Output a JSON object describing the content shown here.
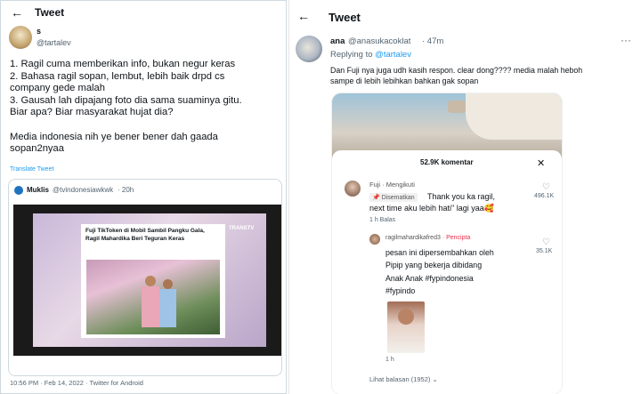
{
  "left": {
    "header_title": "Tweet",
    "author_name": "s",
    "author_handle": "@tartalev",
    "body": "1. Ragil cuma memberikan info, bukan negur keras\n2. Bahasa ragil sopan, lembut, lebih baik drpd cs\ncompany gede malah\n3. Gausah lah dipajang foto dia sama suaminya gitu.\nBiar apa? Biar masyarakat hujat dia?\n\nMedia indonesia nih ye bener bener dah gaada\nsopan2nyaa",
    "translate": "Translate Tweet",
    "quote": {
      "author_name": "Muklis",
      "author_handle": "@tvindonesiawkwk",
      "time": "· 20h",
      "headline_1": "Fuji TikToken di Mobil Sambil Pangku Gala,",
      "headline_2": "Ragil Mahardika Beri Teguran Keras",
      "channel": "TRANSTV"
    },
    "footer": "10:56 PM · Feb 14, 2022 · Twitter for Android"
  },
  "right": {
    "header_title": "Tweet",
    "author_name": "ana",
    "author_handle": "@anasukacoklat",
    "time": "· 47m",
    "reply_prefix": "Replying to ",
    "reply_to": "@tartalev",
    "body": "Dan Fuji nya juga udh kasih respon. clear dong???? media malah heboh\nsampe di lebih lebihkan bahkan gak sopan",
    "tiktok": {
      "comment_count": "52.9K komentar",
      "close": "✕",
      "c1_name": "Fuji",
      "c1_follow": " · Mengikuti",
      "c1_pinned": "Disematkan",
      "c1_text_1": "Thank you ka ragil,",
      "c1_text_2": "next time aku lebih hati\" lagi yaa🥰",
      "c1_meta": "1 h    Balas",
      "c1_likes": "496.1K",
      "c2_name": "ragilmahardikafred3",
      "c2_badge": " · Pencipta",
      "c2_text": "pesan ini dipersembahkan oleh\nPipip yang bekerja dibidang\nAnak Anak #fypindonesia\n#fypindo",
      "c2_meta": "1 h",
      "c2_likes": "35.1K",
      "more": "Lihat balasan (1952)"
    }
  }
}
